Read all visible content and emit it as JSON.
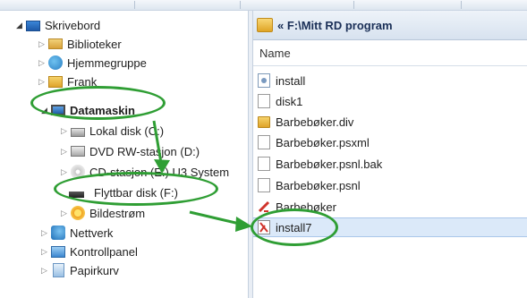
{
  "breadcrumb": {
    "text": "« F:\\Mitt RD program"
  },
  "columns": {
    "name": "Name"
  },
  "tree": [
    {
      "label": "Skrivebord",
      "icon": "desktop-icon"
    },
    {
      "label": "Biblioteker",
      "icon": "libraries-icon"
    },
    {
      "label": "Hjemmegruppe",
      "icon": "homegroup-icon"
    },
    {
      "label": "Frank",
      "icon": "user-folder-icon"
    },
    {
      "label": "Datamaskin",
      "icon": "computer-icon"
    },
    {
      "label": "Lokal disk (C:)",
      "icon": "hard-drive-icon"
    },
    {
      "label": "DVD RW-stasjon (D:)",
      "icon": "dvd-drive-icon"
    },
    {
      "label": "CD-stasjon (E:) U3 System",
      "icon": "cd-drive-icon"
    },
    {
      "label": "Flyttbar disk (F:)",
      "icon": "removable-disk-icon"
    },
    {
      "label": "Bildestrøm",
      "icon": "photo-stream-icon"
    },
    {
      "label": "Nettverk",
      "icon": "network-icon"
    },
    {
      "label": "Kontrollpanel",
      "icon": "control-panel-icon"
    },
    {
      "label": "Papirkurv",
      "icon": "recycle-bin-icon"
    }
  ],
  "files": [
    {
      "name": "install",
      "icon": "setup-config-icon"
    },
    {
      "name": "disk1",
      "icon": "document-icon"
    },
    {
      "name": "Barbebøker.div",
      "icon": "folder-icon"
    },
    {
      "name": "Barbebøker.psxml",
      "icon": "document-icon"
    },
    {
      "name": "Barbebøker.psnl.bak",
      "icon": "document-icon"
    },
    {
      "name": "Barbebøker.psnl",
      "icon": "document-icon"
    },
    {
      "name": "Barbebøker",
      "icon": "app-shortcut-icon"
    },
    {
      "name": "install7",
      "icon": "installer-icon"
    }
  ],
  "colors": {
    "annotation": "#2f9e34",
    "selection": "#dbe9f9"
  }
}
